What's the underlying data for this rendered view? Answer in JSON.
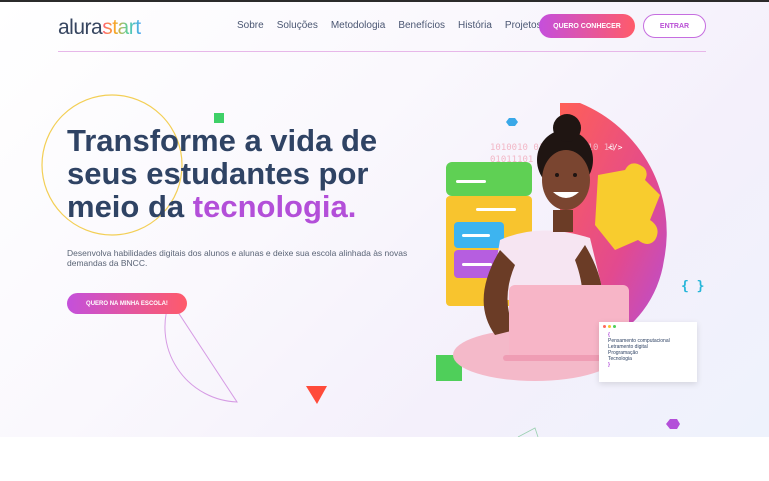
{
  "brand": {
    "logo_part1": "alura",
    "logo_part2": "start"
  },
  "nav": {
    "items": [
      "Sobre",
      "Soluções",
      "Metodologia",
      "Benefícios",
      "História",
      "Projetos"
    ],
    "cta_primary": "QUERO CONHECER",
    "cta_secondary": "ENTRAR"
  },
  "hero": {
    "headline_line1": "Transforme a vida de",
    "headline_line2": "seus estudantes por",
    "headline_line3_prefix": "meio da ",
    "headline_highlight": "tecnologia.",
    "description": "Desenvolva habilidades digitais dos alunos e alunas e deixe sua escola alinhada às novas demandas da BNCC.",
    "cta": "QUERO NA MINHA ESCOLA!"
  },
  "code_card": {
    "open": "{",
    "items": [
      "Pensamento computacional",
      "Letramento digital",
      "Programação",
      "Tecnologia"
    ],
    "close": "}"
  },
  "decor": {
    "braces_icon": "{ }",
    "code_icon": "</>",
    "binary_text": "1010010 0101110 0110 10"
  },
  "colors": {
    "primary": "#2f4364",
    "accent_purple": "#b34fd9",
    "accent_pink": "#ff5b6a"
  }
}
